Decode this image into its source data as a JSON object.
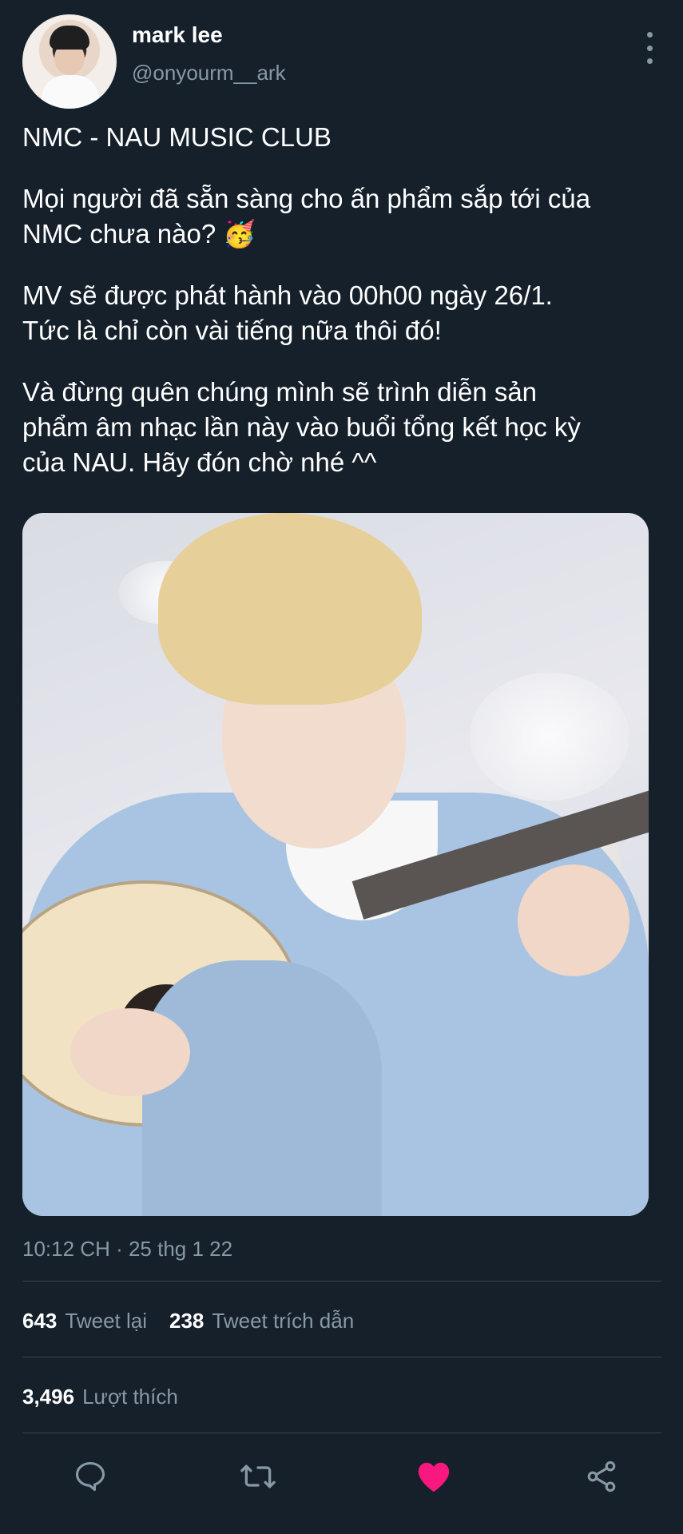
{
  "user": {
    "display_name": "mark lee",
    "handle": "@onyourm__ark"
  },
  "tweet": {
    "paragraphs": [
      "NMC - NAU MUSIC CLUB",
      "Mọi người đã sẵn sàng cho ấn phẩm sắp tới của\nNMC chưa nào? 🥳",
      "MV sẽ được phát hành vào 00h00 ngày 26/1.\nTức là chỉ còn vài tiếng nữa thôi đó!",
      "Và đừng quên chúng mình sẽ trình diễn sản\nphẩm âm nhạc lần này vào buổi tổng kết học kỳ\ncủa NAU. Hãy đón chờ nhé ^^"
    ],
    "timestamp": "10:12 CH · 25 thg 1 22"
  },
  "stats": {
    "retweets_count": "643",
    "retweets_label": "Tweet lại",
    "quotes_count": "238",
    "quotes_label": "Tweet trích dẫn",
    "likes_count": "3,496",
    "likes_label": "Lượt thích"
  },
  "actions": {
    "reply_icon": "reply-icon",
    "retweet_icon": "retweet-icon",
    "like_icon": "heart-icon",
    "share_icon": "share-icon"
  },
  "colors": {
    "background": "#15202b",
    "secondary_text": "#8899a6",
    "like_active": "#f91880"
  }
}
